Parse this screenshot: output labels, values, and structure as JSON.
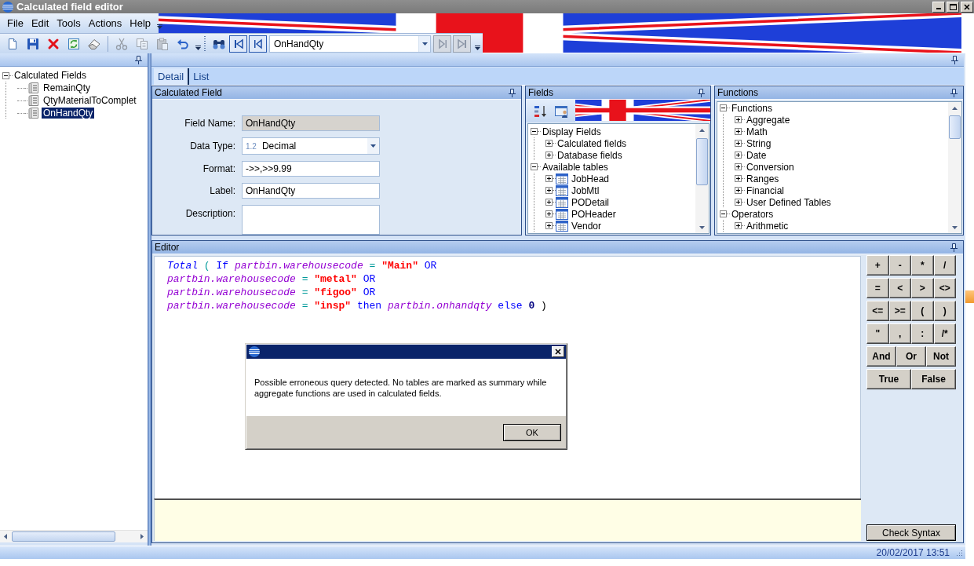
{
  "window": {
    "title": "Calculated field editor"
  },
  "menu": {
    "items": [
      "File",
      "Edit",
      "Tools",
      "Actions",
      "Help"
    ]
  },
  "toolbar": {
    "edit_buttons": [
      {
        "kind": "new",
        "disabled": false
      },
      {
        "kind": "save",
        "disabled": false
      },
      {
        "kind": "delete",
        "disabled": false
      },
      {
        "kind": "refresh",
        "disabled": false
      },
      {
        "kind": "clear",
        "disabled": false
      }
    ],
    "clipboard_buttons": [
      {
        "kind": "cut",
        "disabled": true
      },
      {
        "kind": "copy",
        "disabled": true
      },
      {
        "kind": "paste",
        "disabled": true
      },
      {
        "kind": "undo",
        "disabled": false
      }
    ],
    "find_button": {
      "disabled": false
    },
    "navigation": {
      "back_buttons": [
        {
          "kind": "first",
          "disabled": false
        },
        {
          "kind": "previous",
          "disabled": false
        }
      ],
      "record": "OnHandQty",
      "forward_buttons": [
        {
          "kind": "next",
          "disabled": true
        },
        {
          "kind": "last",
          "disabled": true
        }
      ]
    }
  },
  "explorer": {
    "tree": [
      {
        "label": "Calculated Fields",
        "expanded": true,
        "selected": false,
        "children": [
          {
            "label": "RemainQty",
            "kind": "calculated_field",
            "selected": false
          },
          {
            "label": "QtyMaterialToComplet",
            "kind": "calculated_field",
            "selected": false
          },
          {
            "label": "OnHandQty",
            "kind": "calculated_field",
            "selected": true
          }
        ]
      }
    ]
  },
  "tabs": [
    {
      "label": "Detail",
      "selected": true
    },
    {
      "label": "List",
      "selected": false
    }
  ],
  "calculated_field": {
    "title": "Calculated Field",
    "fields": [
      {
        "kind": "text",
        "label": "Field Name:",
        "value": "OnHandQty",
        "read_only": true
      },
      {
        "kind": "combo",
        "label": "Data Type:",
        "badge": "1.2",
        "value": "Decimal"
      },
      {
        "kind": "text",
        "label": "Format:",
        "value": "->>,>>9.99",
        "read_only": false
      },
      {
        "kind": "text",
        "label": "Label:",
        "value": "OnHandQty",
        "read_only": false
      },
      {
        "kind": "textarea",
        "label": "Description:"
      }
    ]
  },
  "fields_panel": {
    "title": "Fields",
    "tree": [
      {
        "label": "Display Fields",
        "expanded": true,
        "children": [
          {
            "label": "Calculated fields",
            "expanded": false
          },
          {
            "label": "Database fields",
            "expanded": false
          }
        ]
      },
      {
        "label": "Available tables",
        "expanded": true,
        "children": [
          {
            "label": "JobHead",
            "expanded": false,
            "kind": "table"
          },
          {
            "label": "JobMtl",
            "expanded": false,
            "kind": "table"
          },
          {
            "label": "PODetail",
            "expanded": false,
            "kind": "table"
          },
          {
            "label": "POHeader",
            "expanded": false,
            "kind": "table"
          },
          {
            "label": "Vendor",
            "expanded": false,
            "kind": "table"
          }
        ]
      }
    ]
  },
  "functions_panel": {
    "title": "Functions",
    "tree": [
      {
        "label": "Functions",
        "expanded": true,
        "children": [
          {
            "label": "Aggregate",
            "expanded": false
          },
          {
            "label": "Math",
            "expanded": false
          },
          {
            "label": "String",
            "expanded": false
          },
          {
            "label": "Date",
            "expanded": false
          },
          {
            "label": "Conversion",
            "expanded": false
          },
          {
            "label": "Ranges",
            "expanded": false
          },
          {
            "label": "Financial",
            "expanded": false
          },
          {
            "label": "User Defined Tables",
            "expanded": false
          }
        ]
      },
      {
        "label": "Operators",
        "expanded": true,
        "children": [
          {
            "label": "Arithmetic",
            "expanded": false
          }
        ]
      }
    ]
  },
  "editor": {
    "title": "Editor",
    "code": [
      {
        "tokens": [
          {
            "kind": "function",
            "text": "Total"
          },
          {
            "kind": "operator",
            "text": "("
          },
          {
            "kind": "keyword",
            "text": "If"
          },
          {
            "kind": "field",
            "text": "partbin.warehousecode"
          },
          {
            "kind": "operator",
            "text": "="
          },
          {
            "kind": "string",
            "text": "\"Main\""
          },
          {
            "kind": "keyword",
            "text": "OR"
          }
        ]
      },
      {
        "tokens": [
          {
            "kind": "field",
            "text": "partbin.warehousecode"
          },
          {
            "kind": "operator",
            "text": "="
          },
          {
            "kind": "string",
            "text": "\"metal\""
          },
          {
            "kind": "keyword",
            "text": "OR"
          }
        ]
      },
      {
        "tokens": [
          {
            "kind": "field",
            "text": "partbin.warehousecode"
          },
          {
            "kind": "operator",
            "text": "="
          },
          {
            "kind": "string",
            "text": "\"figoo\""
          },
          {
            "kind": "keyword",
            "text": "OR"
          }
        ]
      },
      {
        "tokens": [
          {
            "kind": "field",
            "text": "partbin.warehousecode"
          },
          {
            "kind": "operator",
            "text": "="
          },
          {
            "kind": "string",
            "text": "\"insp\""
          },
          {
            "kind": "keyword",
            "text": "then"
          },
          {
            "kind": "field",
            "text": "partbin.onhandqty"
          },
          {
            "kind": "keyword",
            "text": "else"
          },
          {
            "kind": "number",
            "text": "0"
          },
          {
            "kind": "bracket",
            "text": ")"
          }
        ]
      }
    ],
    "operator_rows": [
      [
        "+",
        "-",
        "*",
        "/"
      ],
      [
        "=",
        "<",
        ">",
        "<>"
      ],
      [
        "<=",
        ">=",
        "(",
        ")"
      ],
      [
        "\"",
        ",",
        ":",
        "/*"
      ],
      [
        "And",
        "Or",
        "Not"
      ],
      [
        "True",
        "False"
      ]
    ],
    "check_button": "Check Syntax"
  },
  "dialog": {
    "message": "Possible erroneous query detected. No tables are marked as summary while aggregate functions are used in calculated fields.",
    "button": "OK"
  },
  "status_bar": {
    "datetime": "20/02/2017 13:51"
  }
}
